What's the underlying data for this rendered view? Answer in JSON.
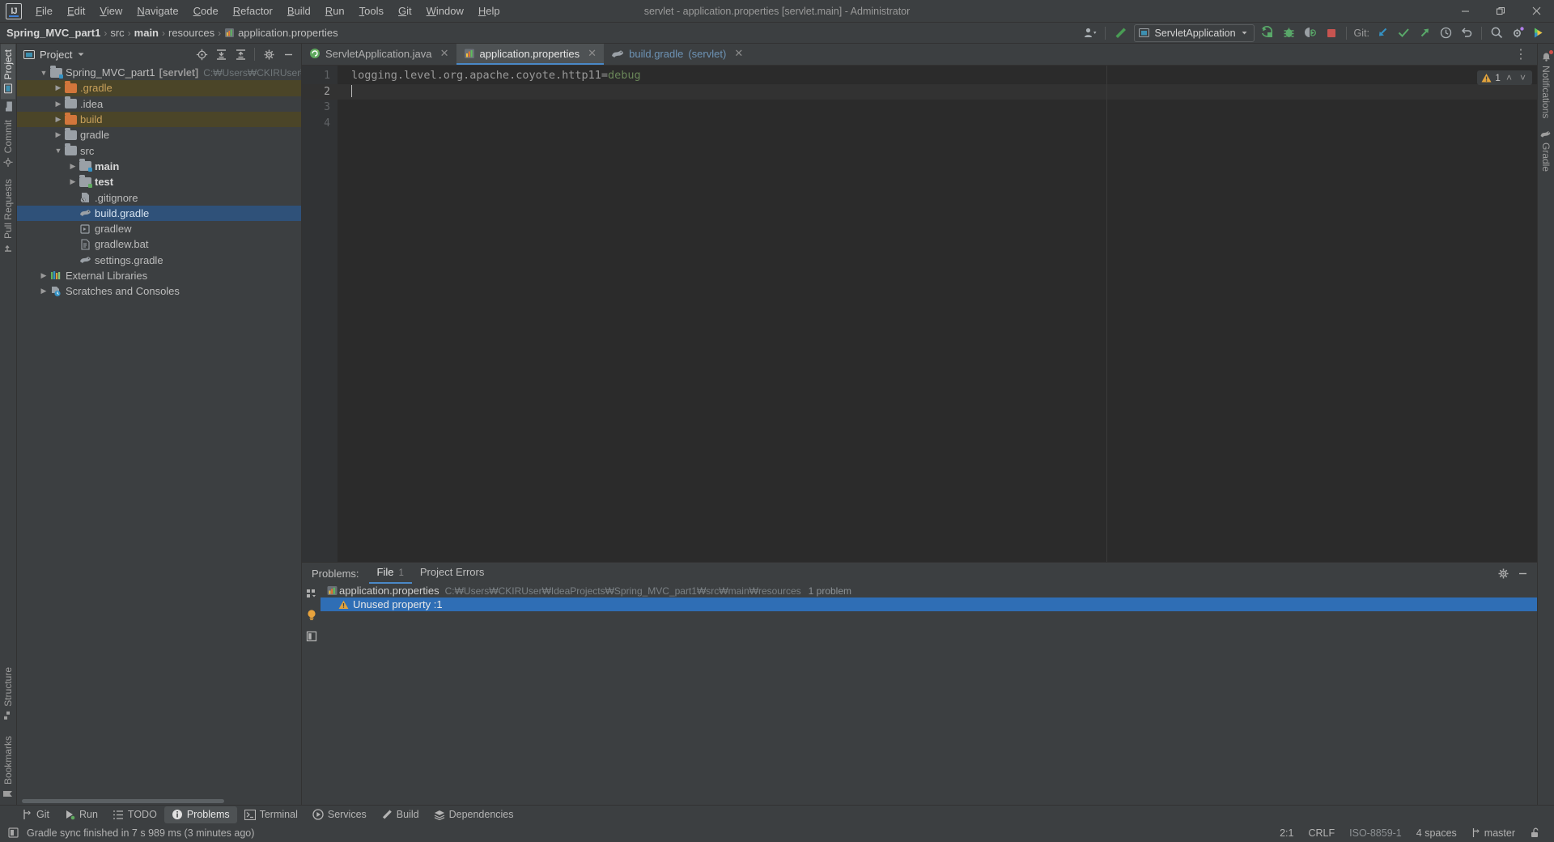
{
  "window": {
    "title": "servlet - application.properties [servlet.main] - Administrator",
    "minimize": "—",
    "maximize": "❐",
    "close": "✕"
  },
  "menu": {
    "items": [
      {
        "label": "File"
      },
      {
        "label": "Edit"
      },
      {
        "label": "View"
      },
      {
        "label": "Navigate"
      },
      {
        "label": "Code"
      },
      {
        "label": "Refactor"
      },
      {
        "label": "Build"
      },
      {
        "label": "Run"
      },
      {
        "label": "Tools"
      },
      {
        "label": "Git"
      },
      {
        "label": "Window"
      },
      {
        "label": "Help"
      }
    ]
  },
  "navbar": {
    "crumbs": [
      {
        "label": "Spring_MVC_part1",
        "bold": true
      },
      {
        "label": "src",
        "bold": false
      },
      {
        "label": "main",
        "bold": true
      },
      {
        "label": "resources",
        "bold": false
      },
      {
        "label": "application.properties",
        "bold": false,
        "icon": "properties-file-icon"
      }
    ],
    "separator": "›",
    "run_config": "ServletApplication",
    "git_label": "Git:",
    "icons": [
      "user-accounts-icon",
      "build-hammer-icon",
      "run-icon",
      "debug-icon",
      "coverage-icon",
      "stop-icon",
      "git-update-icon",
      "git-commit-icon",
      "git-push-icon",
      "history-icon",
      "rollback-icon",
      "search-everywhere-icon",
      "settings-icon",
      "ai-assistant-icon"
    ]
  },
  "left_stripe": {
    "top": [
      {
        "label": "Project",
        "selected": true,
        "icon": "project-icon"
      },
      {
        "label": "Commit",
        "selected": false,
        "icon": "commit-icon"
      },
      {
        "label": "Pull Requests",
        "selected": false,
        "icon": "pull-requests-icon"
      }
    ],
    "bottom": [
      {
        "label": "Structure",
        "icon": "structure-icon"
      },
      {
        "label": "Bookmarks",
        "icon": "bookmarks-icon"
      }
    ]
  },
  "right_stripe": {
    "items": [
      {
        "label": "Notifications",
        "icon": "bell-icon",
        "badge": true
      },
      {
        "label": "Gradle",
        "icon": "gradle-elephant-icon"
      }
    ]
  },
  "project_panel": {
    "title": "Project",
    "dropdown_icon": "chevron-down-icon",
    "header_icons": [
      "select-opened-file-icon",
      "expand-all-icon",
      "collapse-all-icon",
      "settings-icon",
      "hide-icon"
    ],
    "tree": [
      {
        "indent": 0,
        "arrow": "down",
        "icon": "module-folder-icon",
        "label": "Spring_MVC_part1",
        "sub": "[servlet]",
        "meta": "C:₩Users₩CKIRUser₩IdeaPr",
        "state": "normal"
      },
      {
        "indent": 1,
        "arrow": "right",
        "icon": "folder-orange-icon",
        "label": ".gradle",
        "state": "ignored"
      },
      {
        "indent": 1,
        "arrow": "right",
        "icon": "folder-grey-icon",
        "label": ".idea",
        "state": "normal"
      },
      {
        "indent": 1,
        "arrow": "right",
        "icon": "folder-orange-icon",
        "label": "build",
        "state": "ignored"
      },
      {
        "indent": 1,
        "arrow": "right",
        "icon": "folder-grey-icon",
        "label": "gradle",
        "state": "normal"
      },
      {
        "indent": 1,
        "arrow": "down",
        "icon": "folder-grey-icon",
        "label": "src",
        "state": "normal"
      },
      {
        "indent": 2,
        "arrow": "right",
        "icon": "source-folder-icon",
        "label": "main",
        "state": "bold"
      },
      {
        "indent": 2,
        "arrow": "right",
        "icon": "source-folder-icon",
        "label": "test",
        "state": "bold"
      },
      {
        "indent": 2,
        "arrow": "none",
        "icon": "gitignore-file-icon",
        "label": ".gitignore",
        "state": "normal"
      },
      {
        "indent": 2,
        "arrow": "none",
        "icon": "gradle-file-icon",
        "label": "build.gradle",
        "state": "selected"
      },
      {
        "indent": 2,
        "arrow": "none",
        "icon": "script-file-icon",
        "label": "gradlew",
        "state": "normal"
      },
      {
        "indent": 2,
        "arrow": "none",
        "icon": "bat-file-icon",
        "label": "gradlew.bat",
        "state": "normal"
      },
      {
        "indent": 2,
        "arrow": "none",
        "icon": "gradle-file-icon",
        "label": "settings.gradle",
        "state": "normal"
      },
      {
        "indent": 0,
        "arrow": "right",
        "icon": "libraries-icon",
        "label": "External Libraries",
        "state": "normal"
      },
      {
        "indent": 0,
        "arrow": "right",
        "icon": "scratches-icon",
        "label": "Scratches and Consoles",
        "state": "normal"
      }
    ]
  },
  "editor": {
    "tabs": [
      {
        "label": "ServletApplication.java",
        "icon": "spring-boot-class-icon",
        "active": false,
        "suffix": ""
      },
      {
        "label": "application.properties",
        "icon": "properties-file-icon",
        "active": true,
        "suffix": ""
      },
      {
        "label": "build.gradle",
        "icon": "gradle-file-icon",
        "active": false,
        "suffix": "(servlet)"
      }
    ],
    "close_glyph": "✕",
    "lines": [
      {
        "num": "1",
        "key": "logging.level.org.apache.coyote.http11=",
        "value": "debug",
        "current": false
      },
      {
        "num": "2",
        "key": "",
        "value": "",
        "current": true
      },
      {
        "num": "3",
        "key": "",
        "value": "",
        "current": false
      },
      {
        "num": "4",
        "key": "",
        "value": "",
        "current": false
      }
    ],
    "inspection": {
      "warning_icon": "warning-triangle-icon",
      "count": "1",
      "prev_icon": "˄",
      "next_icon": "˅"
    },
    "more_icon": "⋮"
  },
  "problems": {
    "label": "Problems:",
    "tabs": [
      {
        "label": "File",
        "count": "1",
        "selected": true
      },
      {
        "label": "Project Errors",
        "count": "",
        "selected": false
      }
    ],
    "header_icons": [
      "settings-icon",
      "hide-icon"
    ],
    "side_icons": [
      "group-by-icon",
      "lightbulb-icon",
      "preview-icon"
    ],
    "rows": [
      {
        "type": "file",
        "icon": "properties-file-icon",
        "name": "application.properties",
        "path": "C:₩Users₩CKIRUser₩IdeaProjects₩Spring_MVC_part1₩src₩main₩resources",
        "count": "1 problem",
        "selected": false
      },
      {
        "type": "problem",
        "icon": "warning-triangle-icon",
        "message": "Unused property :1",
        "selected": true
      }
    ]
  },
  "bottom_toolbar": {
    "items": [
      {
        "label": "Git",
        "icon": "git-branch-icon",
        "selected": false
      },
      {
        "label": "Run",
        "icon": "run-icon",
        "selected": false
      },
      {
        "label": "TODO",
        "icon": "todo-list-icon",
        "selected": false
      },
      {
        "label": "Problems",
        "icon": "problems-icon",
        "selected": true
      },
      {
        "label": "Terminal",
        "icon": "terminal-icon",
        "selected": false
      },
      {
        "label": "Services",
        "icon": "services-icon",
        "selected": false
      },
      {
        "label": "Build",
        "icon": "build-hammer-icon",
        "selected": false
      },
      {
        "label": "Dependencies",
        "icon": "dependencies-icon",
        "selected": false
      }
    ]
  },
  "statusbar": {
    "icon": "memory-indicator-icon",
    "message": "Gradle sync finished in 7 s 989 ms (3 minutes ago)",
    "right": [
      {
        "label": "2:1",
        "dim": false,
        "name": "caret-position"
      },
      {
        "label": "CRLF",
        "dim": false,
        "name": "line-separator"
      },
      {
        "label": "ISO-8859-1",
        "dim": true,
        "name": "file-encoding"
      },
      {
        "label": "4 spaces",
        "dim": false,
        "name": "indent-setting"
      },
      {
        "label": "master",
        "dim": false,
        "name": "git-branch",
        "icon": "git-branch-icon"
      }
    ],
    "lock_icon": "unlocked-padlock-icon"
  },
  "colors": {
    "bg": "#3c3f41",
    "editor_bg": "#2b2b2b",
    "accent_blue": "#4a88c7",
    "selection": "#2f5179",
    "problem_selection": "#2f6eb5",
    "ignored_folder": "#4b4528",
    "warning": "#e2a33c",
    "green": "#6a8759"
  }
}
